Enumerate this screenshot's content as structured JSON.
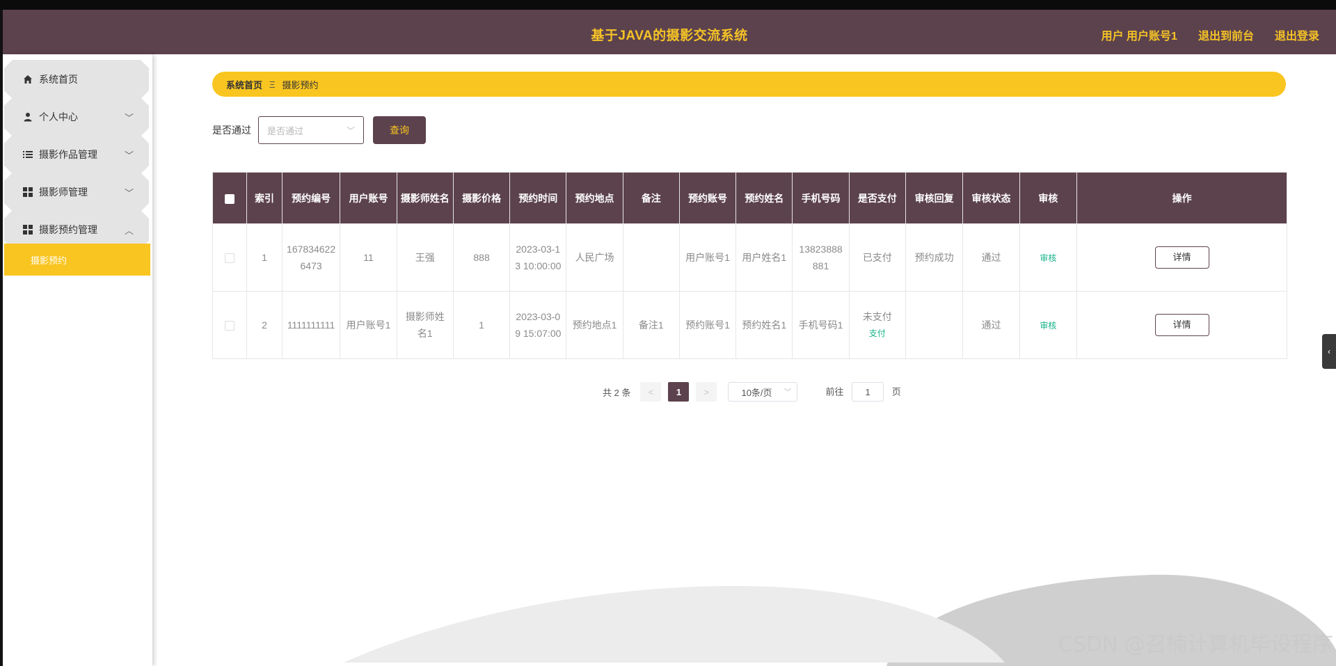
{
  "header": {
    "title": "基于JAVA的摄影交流系统",
    "user_label": "用户 用户账号1",
    "back_label": "退出到前台",
    "logout_label": "退出登录"
  },
  "sidebar": {
    "items": [
      {
        "label": "系统首页",
        "icon": "home-icon"
      },
      {
        "label": "个人中心",
        "icon": "user-icon"
      },
      {
        "label": "摄影作品管理",
        "icon": "list-icon"
      },
      {
        "label": "摄影师管理",
        "icon": "grid-icon"
      },
      {
        "label": "摄影预约管理",
        "icon": "grid-icon"
      }
    ],
    "active_sub": "摄影预约"
  },
  "breadcrumb": {
    "home": "系统首页",
    "separator": "Ξ",
    "current": "摄影预约"
  },
  "filter": {
    "label": "是否通过",
    "placeholder": "是否通过",
    "query_label": "查询"
  },
  "table": {
    "headers": [
      "索引",
      "预约编号",
      "用户账号",
      "摄影师姓名",
      "摄影价格",
      "预约时间",
      "预约地点",
      "备注",
      "预约账号",
      "预约姓名",
      "手机号码",
      "是否支付",
      "审核回复",
      "审核状态",
      "审核",
      "操作"
    ],
    "rows": [
      {
        "index": "1",
        "order_no": "1678346226473",
        "user_account": "11",
        "photographer": "王强",
        "price": "888",
        "time": "2023-03-13 10:00:00",
        "place": "人民广场",
        "remark": "",
        "book_account": "用户账号1",
        "book_name": "用户姓名1",
        "phone": "13823888881",
        "paid": "已支付",
        "pay_link": "",
        "reply": "预约成功",
        "status": "通过",
        "audit": "审核",
        "action": "详情"
      },
      {
        "index": "2",
        "order_no": "1111111111",
        "user_account": "用户账号1",
        "photographer": "摄影师姓名1",
        "price": "1",
        "time": "2023-03-09 15:07:00",
        "place": "预约地点1",
        "remark": "备注1",
        "book_account": "预约账号1",
        "book_name": "预约姓名1",
        "phone": "手机号码1",
        "paid": "未支付",
        "pay_link": "支付",
        "reply": "",
        "status": "通过",
        "audit": "审核",
        "action": "详情"
      }
    ]
  },
  "pagination": {
    "total": "共 2 条",
    "prev": "<",
    "current": "1",
    "next": ">",
    "page_size": "10条/页",
    "goto_label": "前往",
    "goto_value": "1",
    "page_suffix": "页"
  },
  "sidetab_arrow": "‹",
  "watermark": "CSDN @召楠计算机毕设程序",
  "colors": {
    "primary": "#5c424d",
    "accent": "#f9c520",
    "success": "#17b38a"
  }
}
